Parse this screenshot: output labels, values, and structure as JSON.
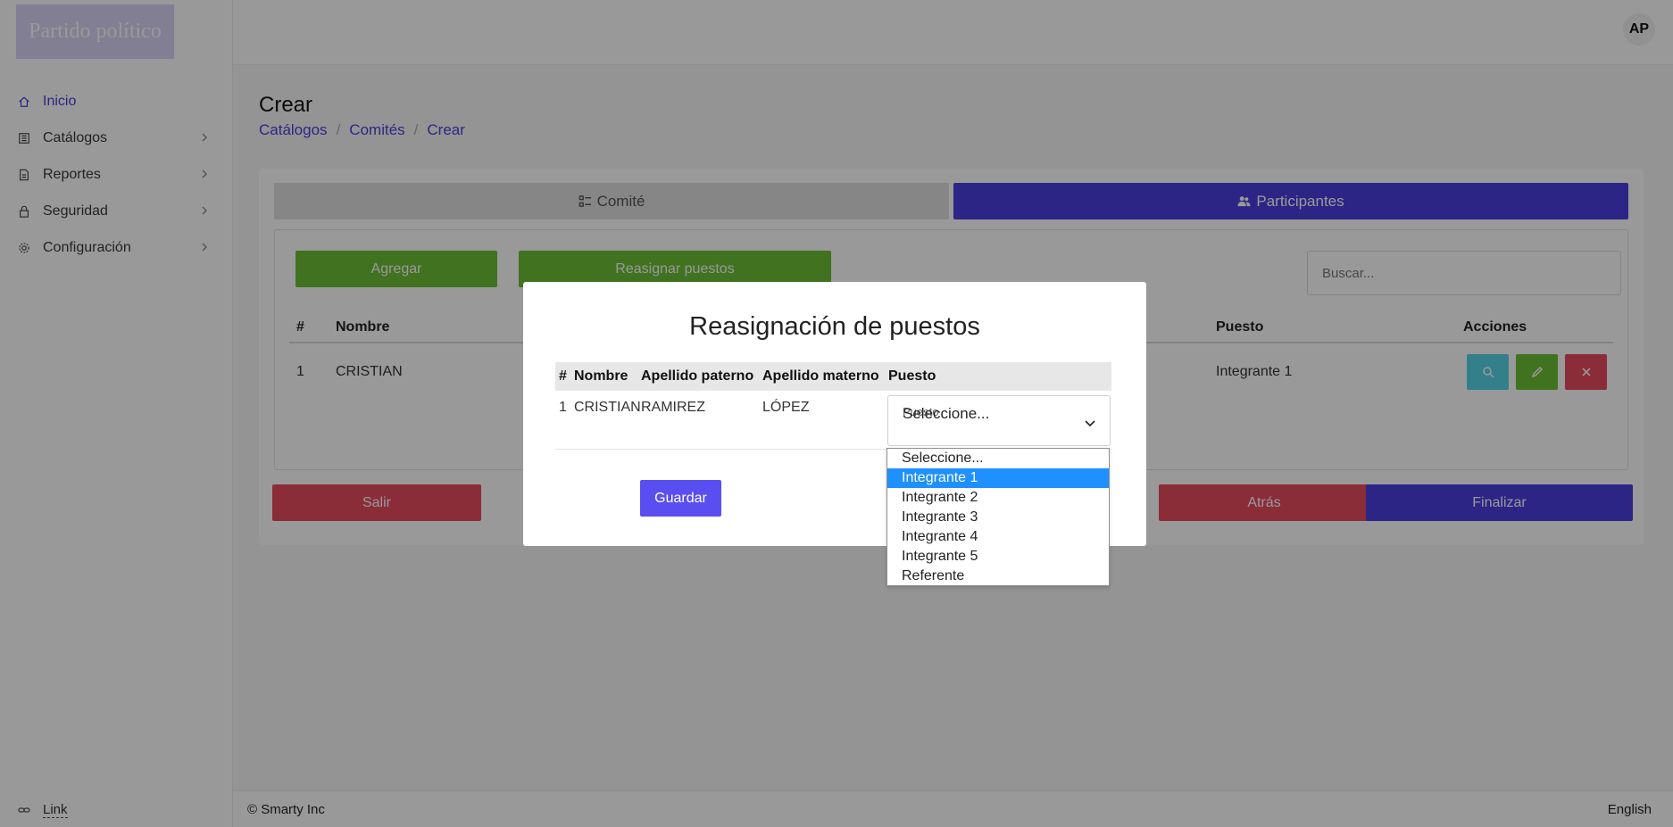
{
  "sidebar": {
    "logo": "Partido político",
    "items": [
      {
        "label": "Inicio",
        "icon": "home-icon"
      },
      {
        "label": "Catálogos",
        "icon": "catalog-icon"
      },
      {
        "label": "Reportes",
        "icon": "report-icon"
      },
      {
        "label": "Seguridad",
        "icon": "lock-icon"
      },
      {
        "label": "Configuración",
        "icon": "gear-icon"
      }
    ],
    "footer_link": "Link"
  },
  "header": {
    "avatar_initials": "AP"
  },
  "page": {
    "title": "Crear",
    "breadcrumb": [
      "Catálogos",
      "Comités",
      "Crear"
    ]
  },
  "tabs": {
    "comite": "Comité",
    "participantes": "Participantes"
  },
  "toolbar": {
    "add_label": "Agregar",
    "reassign_label": "Reasignar puestos",
    "search_placeholder": "Buscar..."
  },
  "table": {
    "headers": {
      "num": "#",
      "nombre": "Nombre",
      "puesto": "Puesto",
      "acciones": "Acciones"
    },
    "rows": [
      {
        "num": "1",
        "nombre": "CRISTIAN",
        "puesto": "Integrante 1"
      }
    ]
  },
  "actions": {
    "exit_label": "Salir",
    "back_label": "Atrás",
    "finish_label": "Finalizar"
  },
  "modal": {
    "title": "Reasignación de puestos",
    "headers": {
      "num": "#",
      "nombre": "Nombre",
      "paterno": "Apellido paterno",
      "materno": "Apellido materno",
      "puesto": "Puesto"
    },
    "row": {
      "num": "1",
      "nombre": "CRISTIAN",
      "paterno": "RAMIREZ",
      "materno": "LÓPEZ"
    },
    "select": {
      "label": "Puesto",
      "value": "Seleccione..."
    },
    "save_label": "Guardar"
  },
  "dropdown": {
    "options": [
      "Seleccione...",
      "Integrante 1",
      "Integrante 2",
      "Integrante 3",
      "Integrante 4",
      "Integrante 5",
      "Referente"
    ],
    "highlighted": "Integrante 1"
  },
  "footer": {
    "copyright": "© Smarty Inc",
    "language": "English"
  },
  "colors": {
    "accent": "#4a3fe0",
    "success": "#6dbf36",
    "danger": "#e84a5f",
    "info": "#55d6e6"
  }
}
